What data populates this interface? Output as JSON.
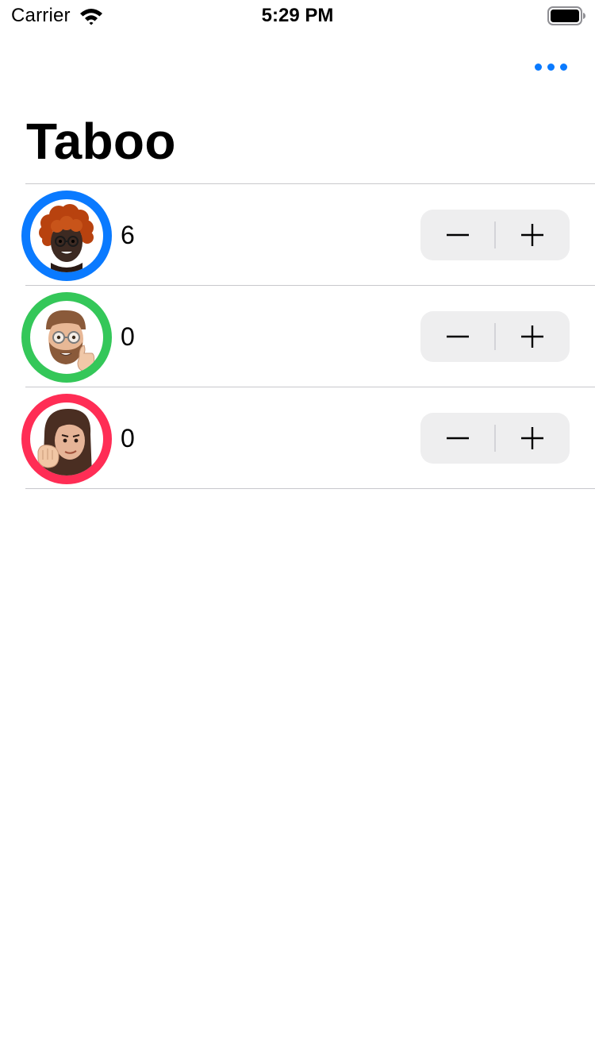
{
  "status_bar": {
    "carrier": "Carrier",
    "time": "5:29 PM",
    "icons": [
      "wifi-icon",
      "battery-icon"
    ]
  },
  "nav": {
    "more_icon": "ellipsis-icon",
    "accent": "#0a7aff"
  },
  "title": "Taboo",
  "players": [
    {
      "ring_color": "#0a7aff",
      "avatar": "memoji-curly-red-hair",
      "score": "6",
      "minus_label": "−",
      "plus_label": "+"
    },
    {
      "ring_color": "#34c759",
      "avatar": "memoji-beard-glasses-thumbs-up",
      "score": "0",
      "minus_label": "−",
      "plus_label": "+"
    },
    {
      "ring_color": "#ff2d55",
      "avatar": "memoji-long-hair-fist",
      "score": "0",
      "minus_label": "−",
      "plus_label": "+"
    }
  ]
}
